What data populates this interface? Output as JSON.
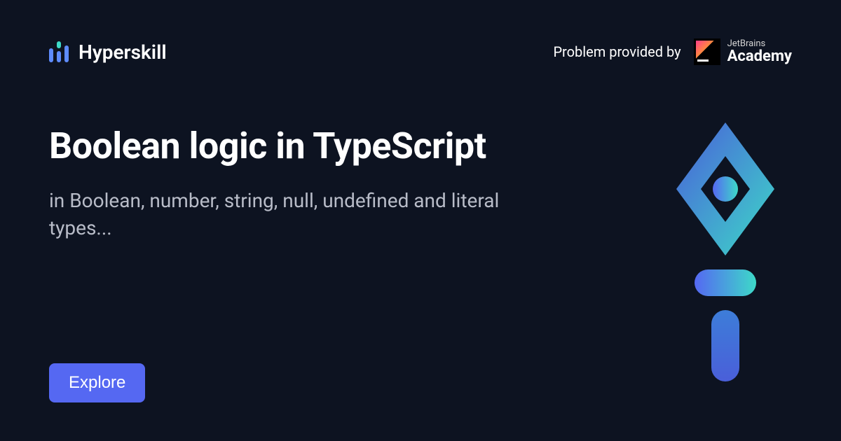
{
  "header": {
    "brand_name": "Hyperskill",
    "provider_text": "Problem provided by",
    "jetbrains_label": "JetBrains",
    "academy_label": "Academy"
  },
  "main": {
    "title": "Boolean logic in TypeScript",
    "subtitle": "in Boolean, number, string, null, undefined and literal types..."
  },
  "cta": {
    "explore_label": "Explore"
  }
}
